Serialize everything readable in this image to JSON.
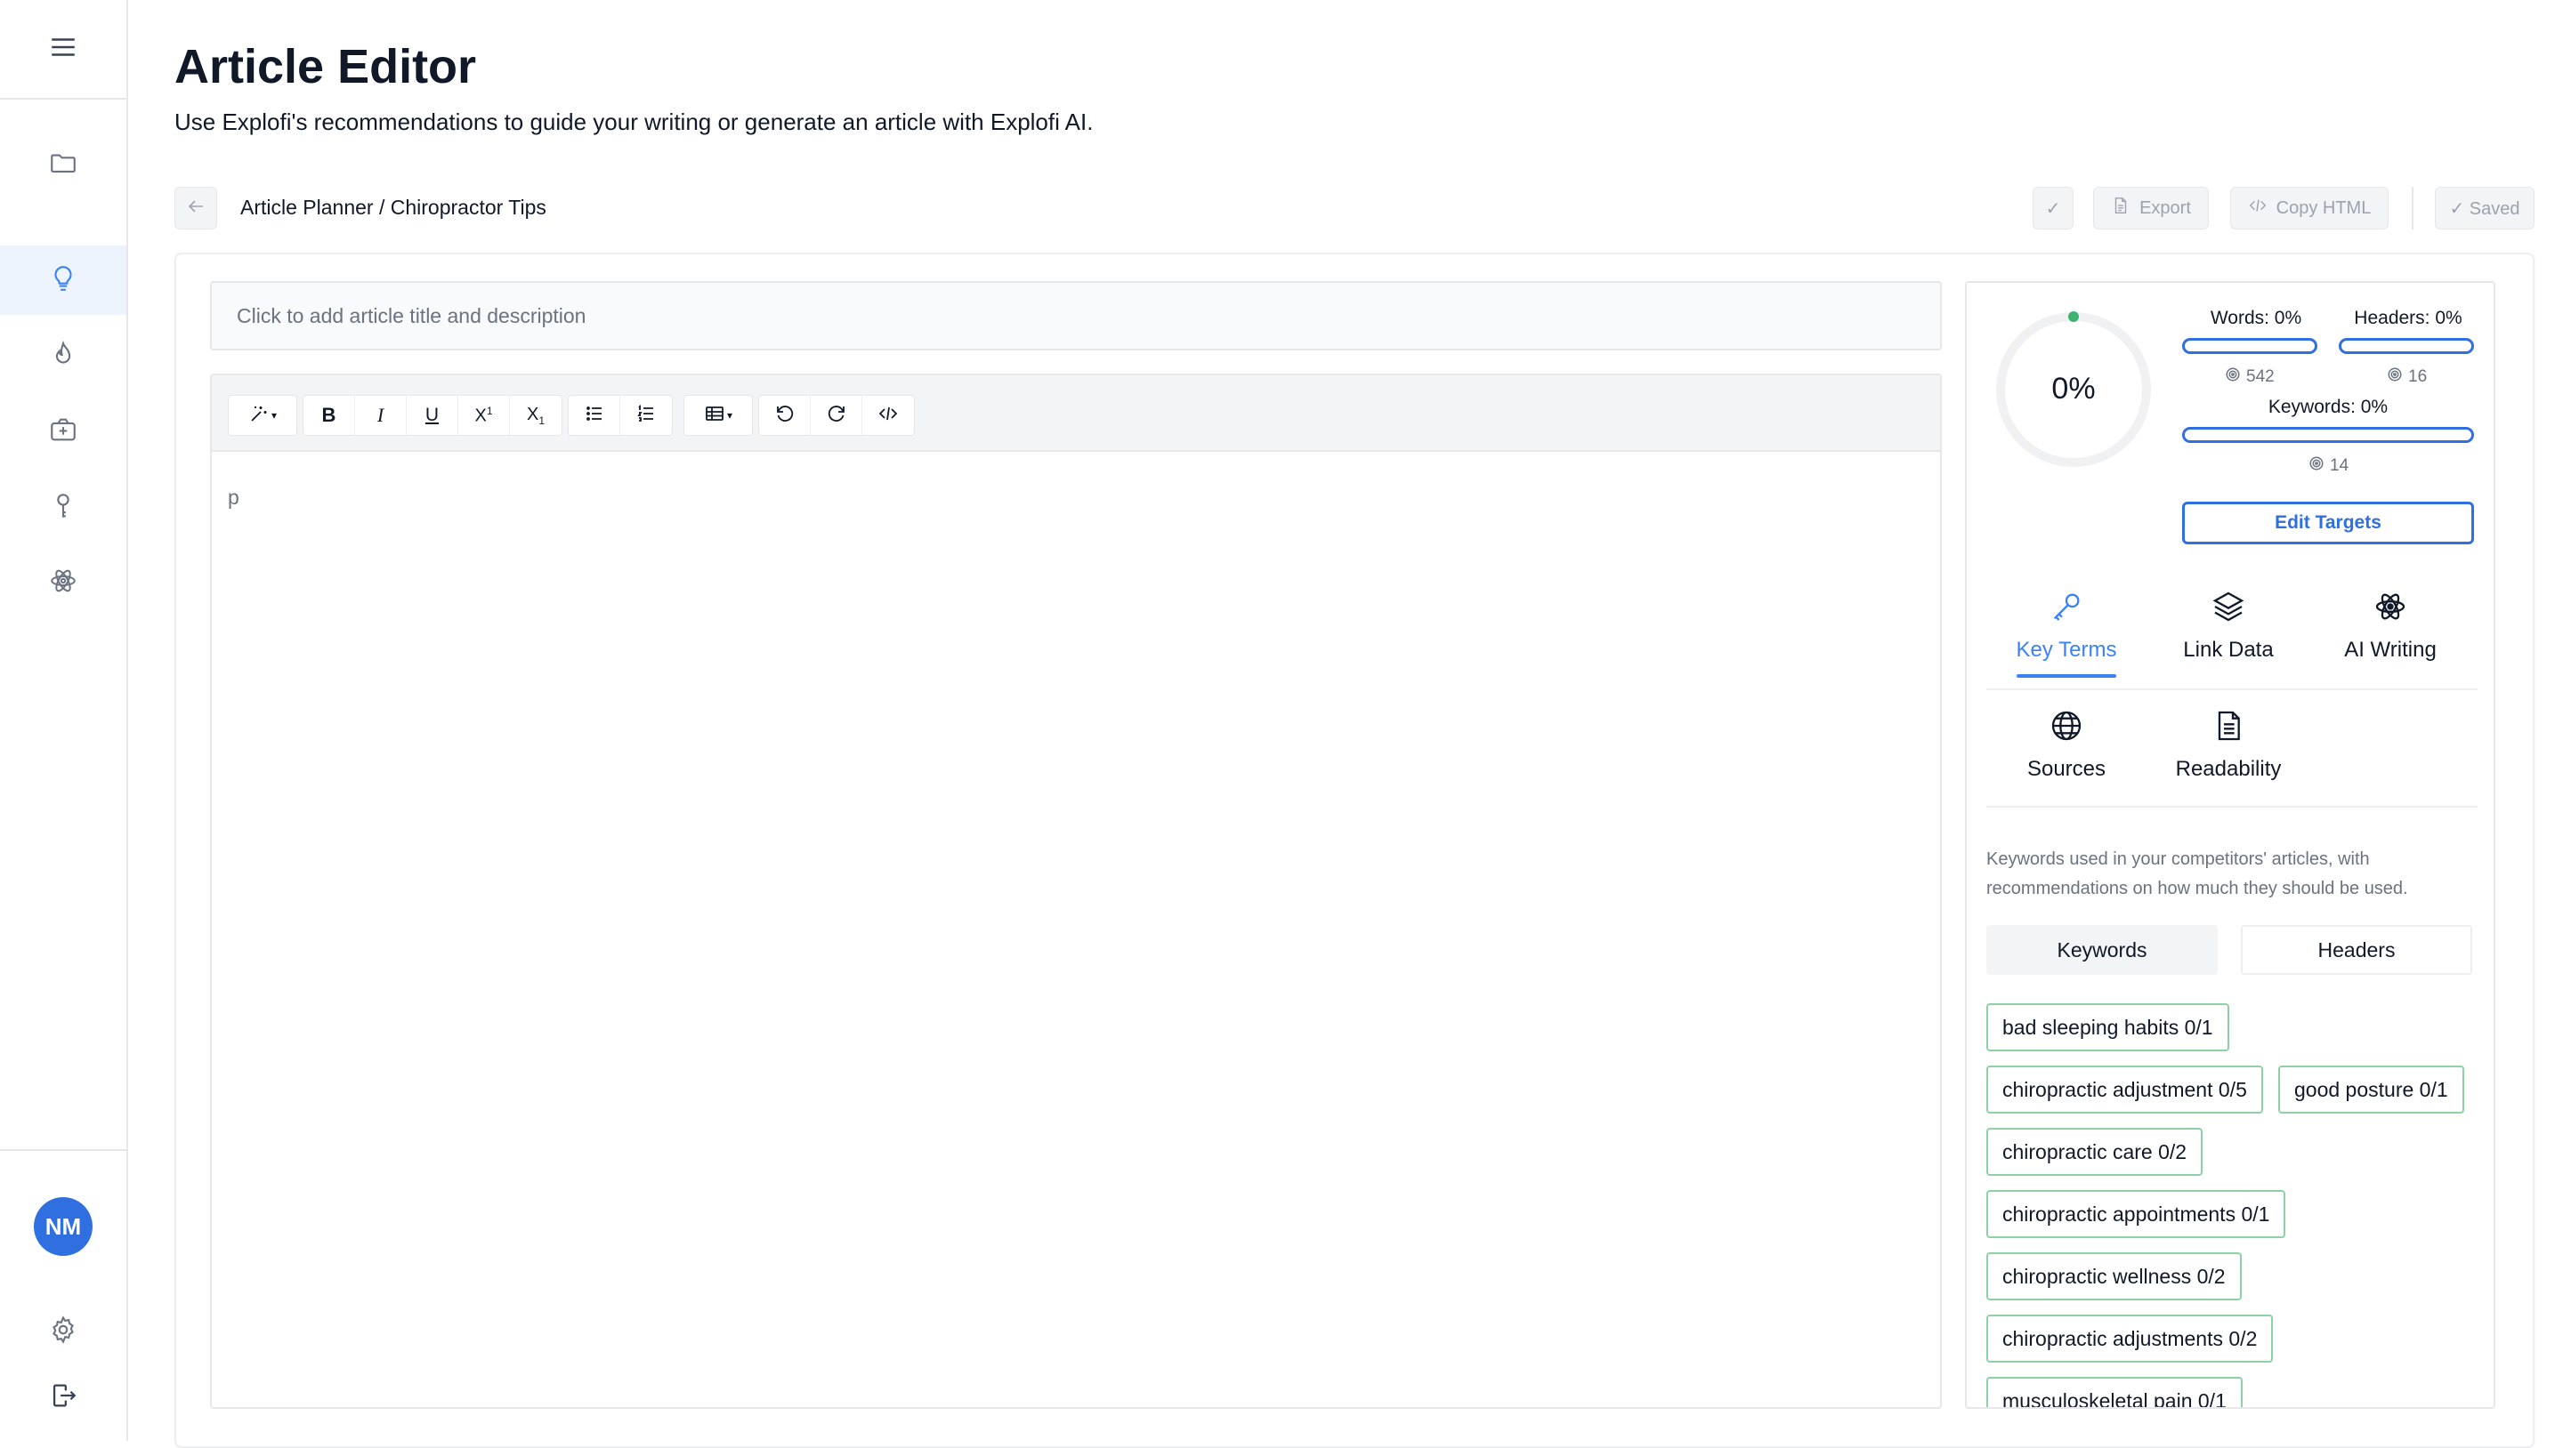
{
  "sidebar": {
    "menu_icon": "hamburger-icon",
    "items": [
      {
        "icon": "folder-icon",
        "active": false
      },
      {
        "icon": "lightbulb-icon",
        "active": true
      },
      {
        "icon": "flame-icon",
        "active": false
      },
      {
        "icon": "camera-plus-icon",
        "active": false
      },
      {
        "icon": "key-icon",
        "active": false
      },
      {
        "icon": "atom-icon",
        "active": false
      }
    ],
    "avatar_initials": "NM",
    "settings_icon": "gear-icon",
    "logout_icon": "logout-icon"
  },
  "header": {
    "title": "Article Editor",
    "subtitle": "Use Explofi's recommendations to guide your writing or generate an article with Explofi AI."
  },
  "breadcrumb": "Article Planner / Chiropractor Tips",
  "toolbar": {
    "check_label": "✓",
    "export_label": "Export",
    "copy_html_label": "Copy HTML",
    "saved_label": "✓ Saved"
  },
  "editor": {
    "title_placeholder": "Click to add article title and description",
    "body_text": "p",
    "toolbar_buttons": [
      "magic-wand",
      "bold",
      "italic",
      "underline",
      "superscript",
      "subscript",
      "bullet-list",
      "ordered-list",
      "table",
      "undo",
      "redo",
      "code-view"
    ]
  },
  "panel": {
    "score": "0%",
    "words_label": "Words: 0%",
    "words_target": "542",
    "headers_label": "Headers: 0%",
    "headers_target": "16",
    "keywords_label": "Keywords: 0%",
    "keywords_target": "14",
    "edit_targets_label": "Edit Targets",
    "tabs": [
      {
        "label": "Key Terms",
        "icon": "key-icon",
        "active": true
      },
      {
        "label": "Link Data",
        "icon": "layers-icon",
        "active": false
      },
      {
        "label": "AI Writing",
        "icon": "atom-icon",
        "active": false
      },
      {
        "label": "Sources",
        "icon": "globe-icon",
        "active": false
      },
      {
        "label": "Readability",
        "icon": "document-icon",
        "active": false
      }
    ],
    "description": "Keywords used in your competitors' articles, with recommendations on how much they should be used.",
    "segments": {
      "keywords": "Keywords",
      "headers": "Headers"
    },
    "chips": [
      "bad sleeping habits 0/1",
      "chiropractic adjustment 0/5",
      "good posture 0/1",
      "chiropractic care 0/2",
      "chiropractic appointments 0/1",
      "chiropractic wellness 0/2",
      "chiropractic adjustments 0/2",
      "musculoskeletal pain 0/1"
    ]
  },
  "colors": {
    "accent": "#2f6fe0",
    "active_tab": "#3b82f6",
    "chip_border": "#8fd1a6",
    "status_dot": "#3cb371"
  }
}
